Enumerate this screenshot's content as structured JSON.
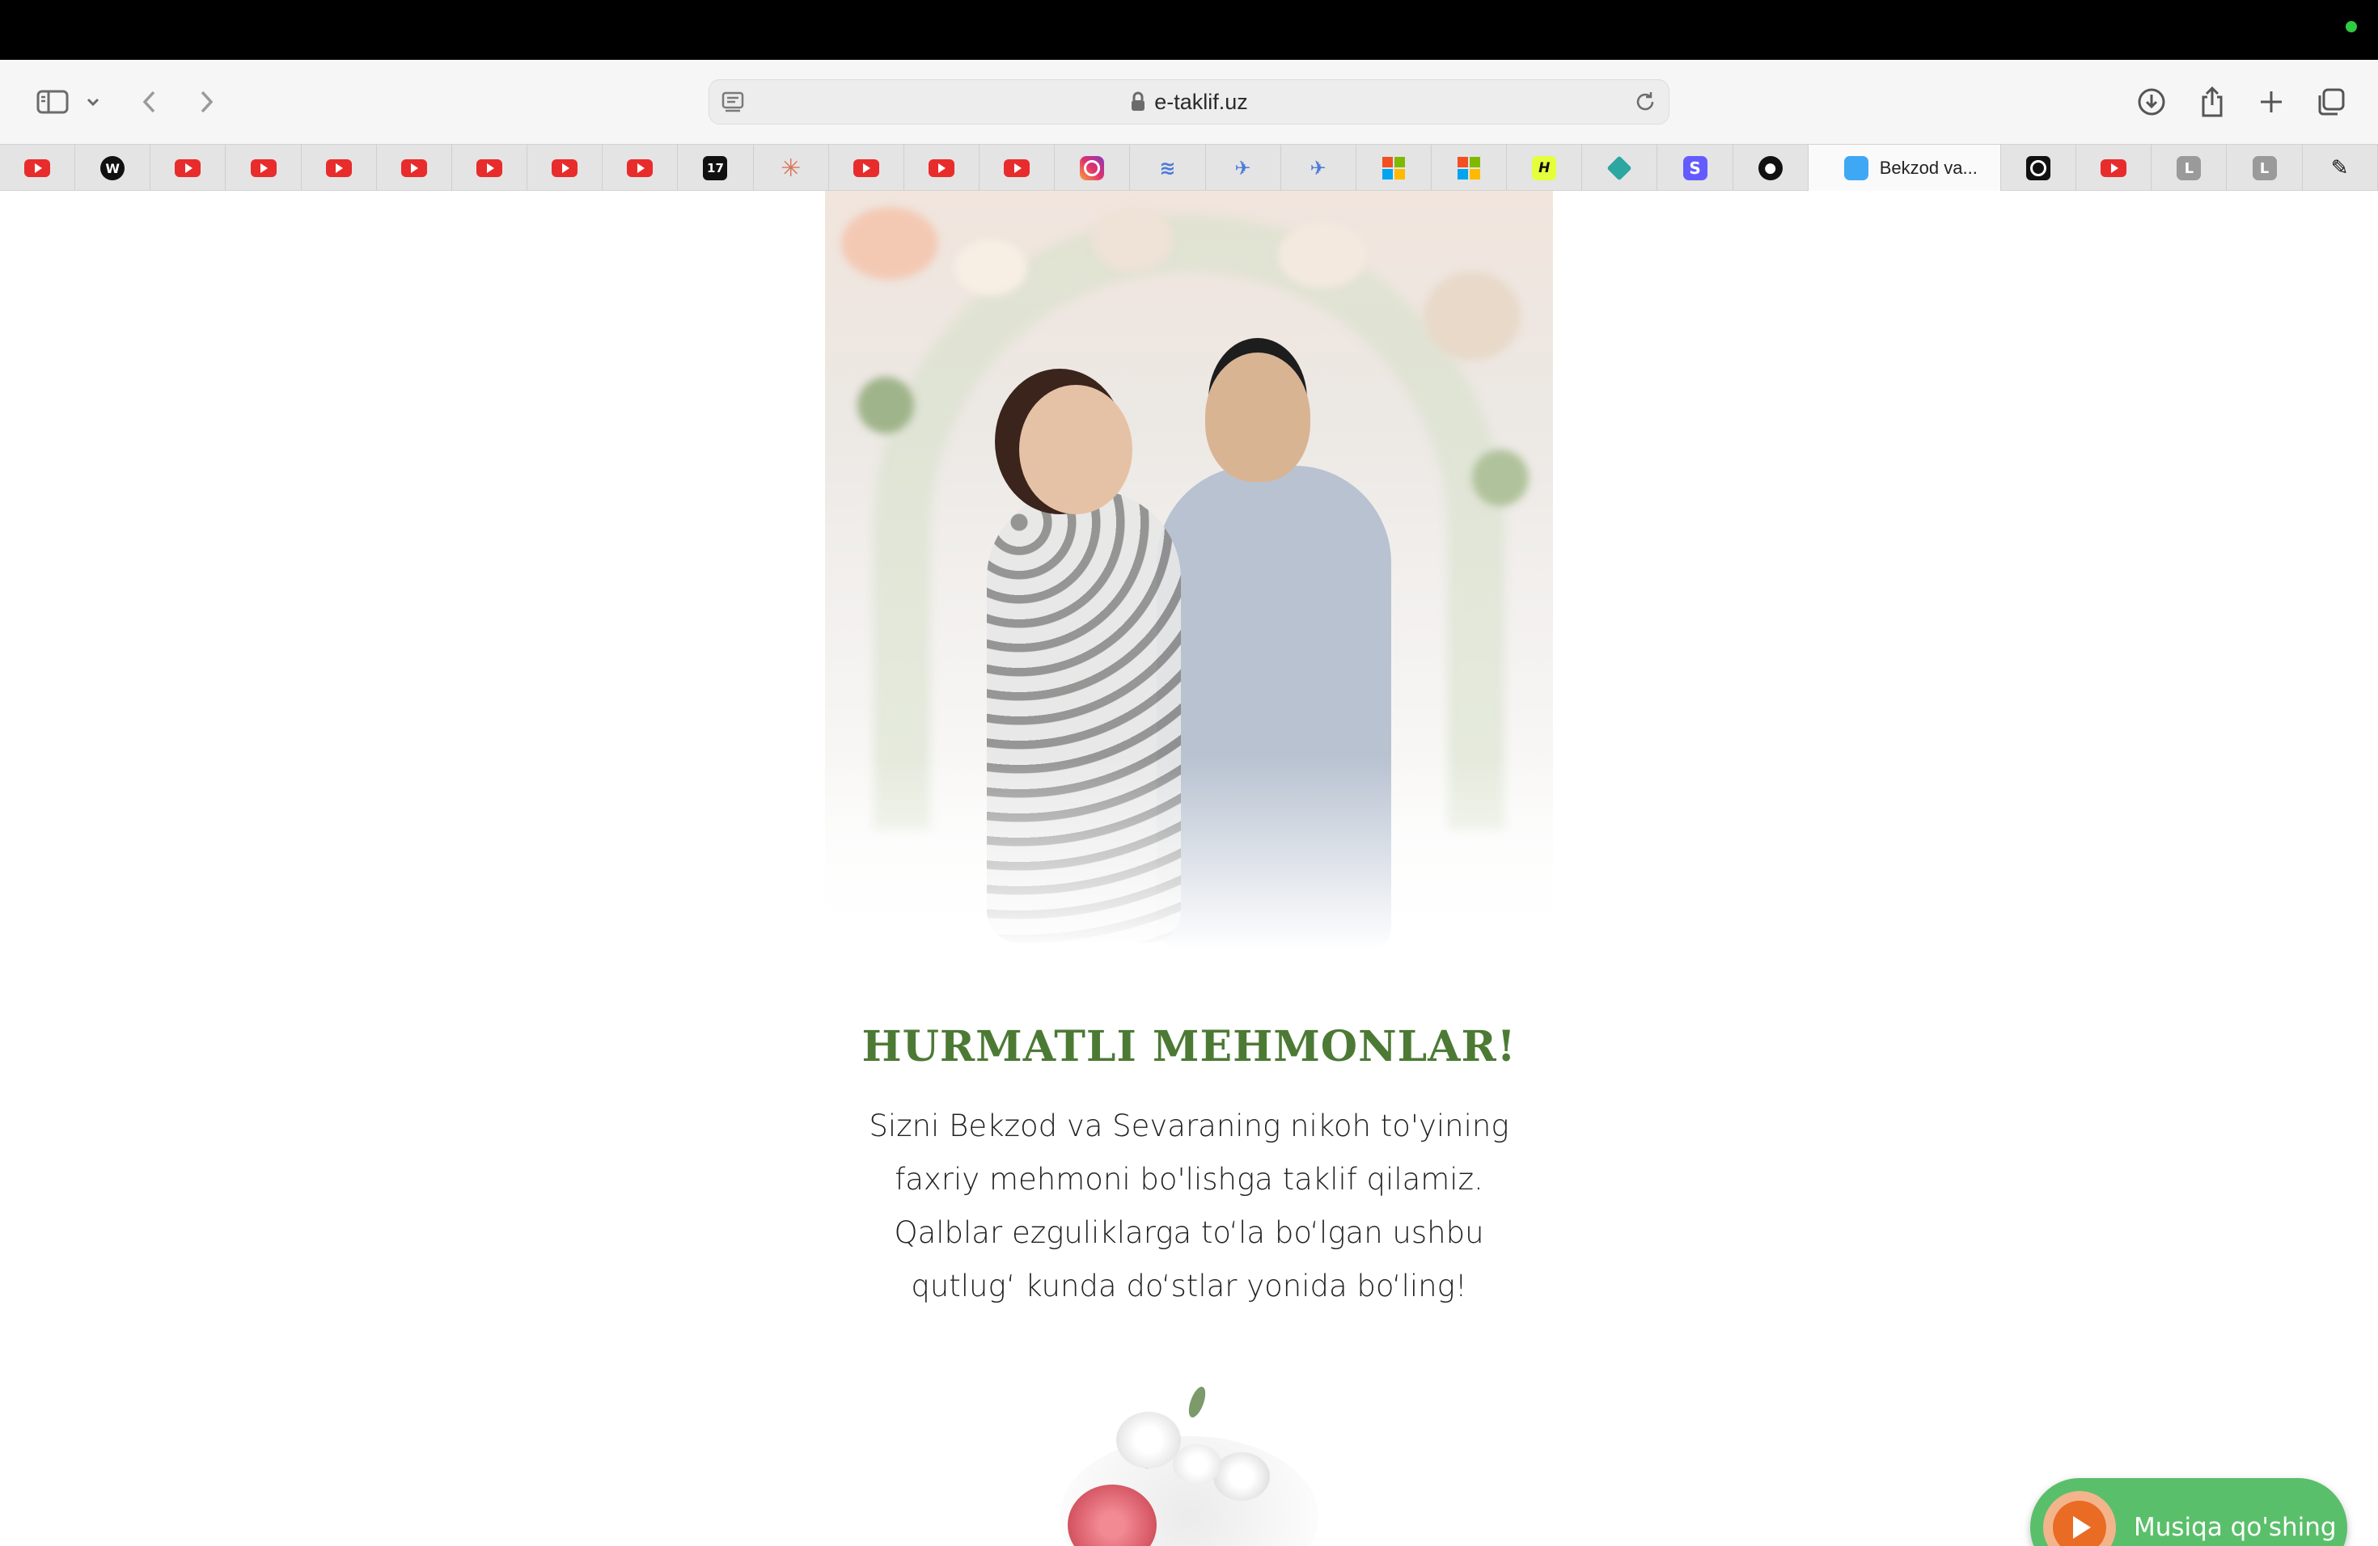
{
  "browser": {
    "url": "e-taklif.uz",
    "active_tab_title": "Bekzod va...",
    "tabs": [
      {
        "icon": "youtube"
      },
      {
        "icon": "w-logo",
        "glyph": "W"
      },
      {
        "icon": "youtube"
      },
      {
        "icon": "youtube"
      },
      {
        "icon": "youtube"
      },
      {
        "icon": "youtube"
      },
      {
        "icon": "youtube"
      },
      {
        "icon": "youtube"
      },
      {
        "icon": "youtube"
      },
      {
        "icon": "tradingview",
        "glyph": "17"
      },
      {
        "icon": "claude",
        "glyph": "✳"
      },
      {
        "icon": "youtube"
      },
      {
        "icon": "youtube"
      },
      {
        "icon": "youtube"
      },
      {
        "icon": "instagram"
      },
      {
        "icon": "wave",
        "glyph": "≋"
      },
      {
        "icon": "bird",
        "glyph": "✈"
      },
      {
        "icon": "bird",
        "glyph": "✈"
      },
      {
        "icon": "microsoft"
      },
      {
        "icon": "microsoft"
      },
      {
        "icon": "h-logo",
        "glyph": "H"
      },
      {
        "icon": "diamond"
      },
      {
        "icon": "s-logo",
        "glyph": "S"
      },
      {
        "icon": "github",
        "glyph": "●"
      },
      {
        "icon": "active"
      },
      {
        "icon": "ring"
      },
      {
        "icon": "youtube"
      },
      {
        "icon": "l-logo",
        "glyph": "L"
      },
      {
        "icon": "l-logo",
        "glyph": "L"
      },
      {
        "icon": "pen",
        "glyph": "✎"
      }
    ]
  },
  "invitation": {
    "heading": "HURMATLI MEHMONLAR!",
    "lines": [
      "Sizni Bekzod va Sevaraning nikoh to'yining",
      "faxriy mehmoni bo'lishga taklif qilamiz.",
      "Qalblar ezguliklarga to‘la bo‘lgan ushbu",
      "qutlug‘ kunda do‘stlar yonida bo‘ling!"
    ]
  },
  "music_button": {
    "label": "Musiqa qo'shing"
  },
  "colors": {
    "heading": "#4c7a35",
    "music_button_bg": "#5abf6a",
    "play_circle": "#ea6b23"
  }
}
